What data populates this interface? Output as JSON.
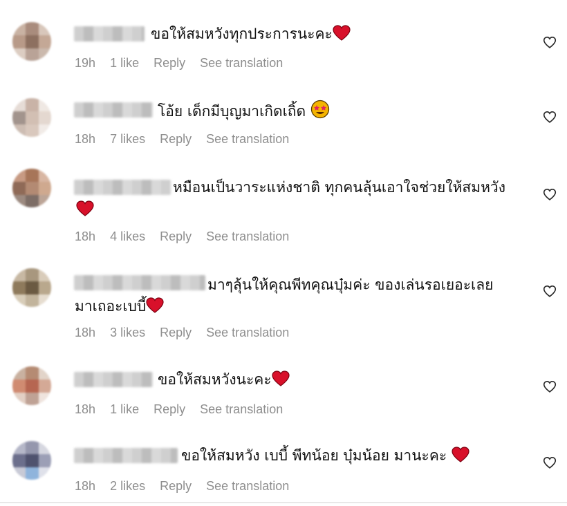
{
  "comments": [
    {
      "text": "ขอให้สมหวังทุกประการนะคะ",
      "trail": "heart",
      "time": "19h",
      "likes": "1 like",
      "reply": "Reply",
      "see": "See translation",
      "avatar": [
        "#c9b2a3",
        "#a98c7d",
        "#d8c7bb",
        "#b89a88",
        "#8d7060",
        "#c4a896",
        "#dccdc2",
        "#b9a397",
        "#cbb9ad"
      ]
    },
    {
      "text": "โอ้ย เด็กมีบุญมาเกิดเถิ้ด",
      "trail": "star-eyes",
      "time": "18h",
      "likes": "7 likes",
      "reply": "Reply",
      "see": "See translation",
      "avatar": [
        "#e6dcd6",
        "#c9b3a7",
        "#efe8e3",
        "#a2948d",
        "#d2bfb3",
        "#e4d8d0",
        "#cdbdb3",
        "#d9c8bd",
        "#f1ebe7"
      ]
    },
    {
      "text": "หมือนเป็นวาระแห่งชาติ ทุกคนลุ้นเอาใจช่วยให้สมหวัง",
      "trail": "heart-newline",
      "time": "18h",
      "likes": "4 likes",
      "reply": "Reply",
      "see": "See translation",
      "avatar": [
        "#c79a83",
        "#a77559",
        "#d8b6a2",
        "#8f6a57",
        "#b38a73",
        "#cfa98f",
        "#9c8a80",
        "#7d6d66",
        "#bca597"
      ]
    },
    {
      "text": "มาๆลุ้นให้คุณพีทคุณบุ๋มค่ะ ของเล่นรอเยอะเลย",
      "line2": "มาเถอะเบบี้",
      "trail": "heart-line2",
      "time": "18h",
      "likes": "3 likes",
      "reply": "Reply",
      "see": "See translation",
      "avatar": [
        "#c7b8a3",
        "#a8977e",
        "#d9ccba",
        "#8e7a5c",
        "#6b5a42",
        "#b9a88d",
        "#d8cdb9",
        "#c2b49c",
        "#e6ddd0"
      ]
    },
    {
      "text": "ขอให้สมหวังนะคะ",
      "trail": "heart",
      "time": "18h",
      "likes": "1 like",
      "reply": "Reply",
      "see": "See translation",
      "avatar": [
        "#c9b1a0",
        "#b58b73",
        "#e2d4c9",
        "#d08b71",
        "#b66651",
        "#d4a996",
        "#e2cfc4",
        "#bfa295",
        "#efe4de"
      ]
    },
    {
      "text": "ขอให้สมหวัง เบบี้ พีทน้อย บุ๋มน้อย มานะคะ",
      "trail": "heart",
      "time": "18h",
      "likes": "2 likes",
      "reply": "Reply",
      "see": "See translation",
      "avatar": [
        "#b5b7c8",
        "#9597ad",
        "#d6d7e0",
        "#6c6f8c",
        "#4f526e",
        "#9c9fb6",
        "#c8cad6",
        "#8fb4dc",
        "#dfe1ea"
      ]
    }
  ]
}
